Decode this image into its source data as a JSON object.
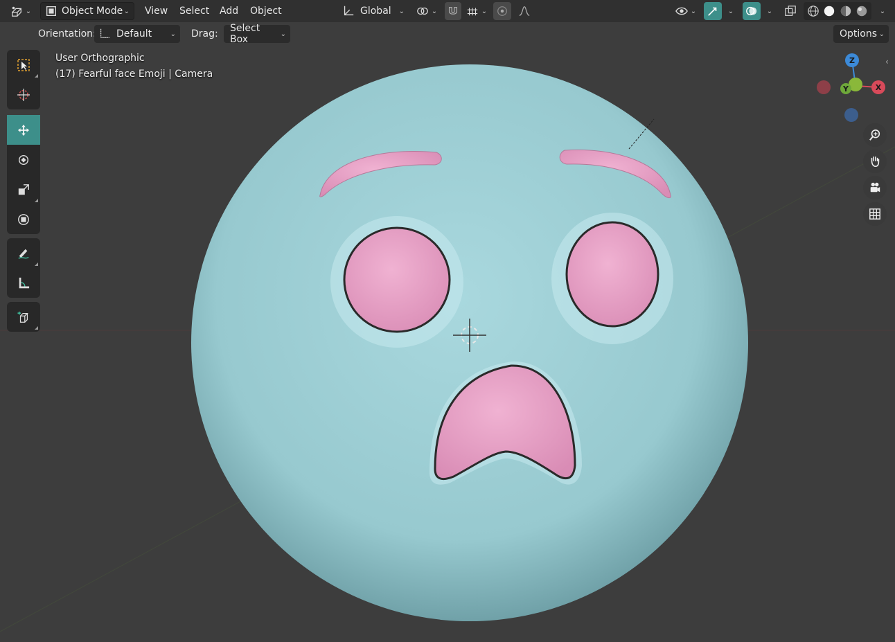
{
  "header": {
    "editor_type_icon": "editor-type-icon",
    "mode_label": "Object Mode",
    "menus": [
      "View",
      "Select",
      "Add",
      "Object"
    ],
    "transform_orientation": "Global",
    "pivot_icon": "pivot-icon",
    "snap_icon": "snap-magnet-icon",
    "proportional_icon": "proportional-edit-icon"
  },
  "tool_settings": {
    "orientation_label": "Orientation:",
    "orientation_value": "Default",
    "drag_label": "Drag:",
    "drag_value": "Select Box",
    "options_label": "Options"
  },
  "viewport": {
    "view_name": "User Orthographic",
    "object_info": "(17) Fearful face Emoji | Camera",
    "colors": {
      "face": "#a8d6dc",
      "features": "#e8a6c8",
      "background": "#3d3d3d",
      "active_tool": "#3d8f8a"
    }
  },
  "tools": [
    {
      "name": "select-box-tool",
      "icon": "select-box-icon"
    },
    {
      "name": "cursor-tool",
      "icon": "cursor-icon"
    },
    {
      "name": "move-tool",
      "icon": "move-icon",
      "active": true
    },
    {
      "name": "rotate-tool",
      "icon": "rotate-icon"
    },
    {
      "name": "scale-tool",
      "icon": "scale-icon"
    },
    {
      "name": "transform-tool",
      "icon": "transform-icon"
    },
    {
      "name": "annotate-tool",
      "icon": "annotate-icon"
    },
    {
      "name": "measure-tool",
      "icon": "measure-icon"
    },
    {
      "name": "add-cube-tool",
      "icon": "add-cube-icon"
    }
  ],
  "gizmo": {
    "z_label": "Z",
    "y_label": "Y",
    "x_label": "X"
  }
}
